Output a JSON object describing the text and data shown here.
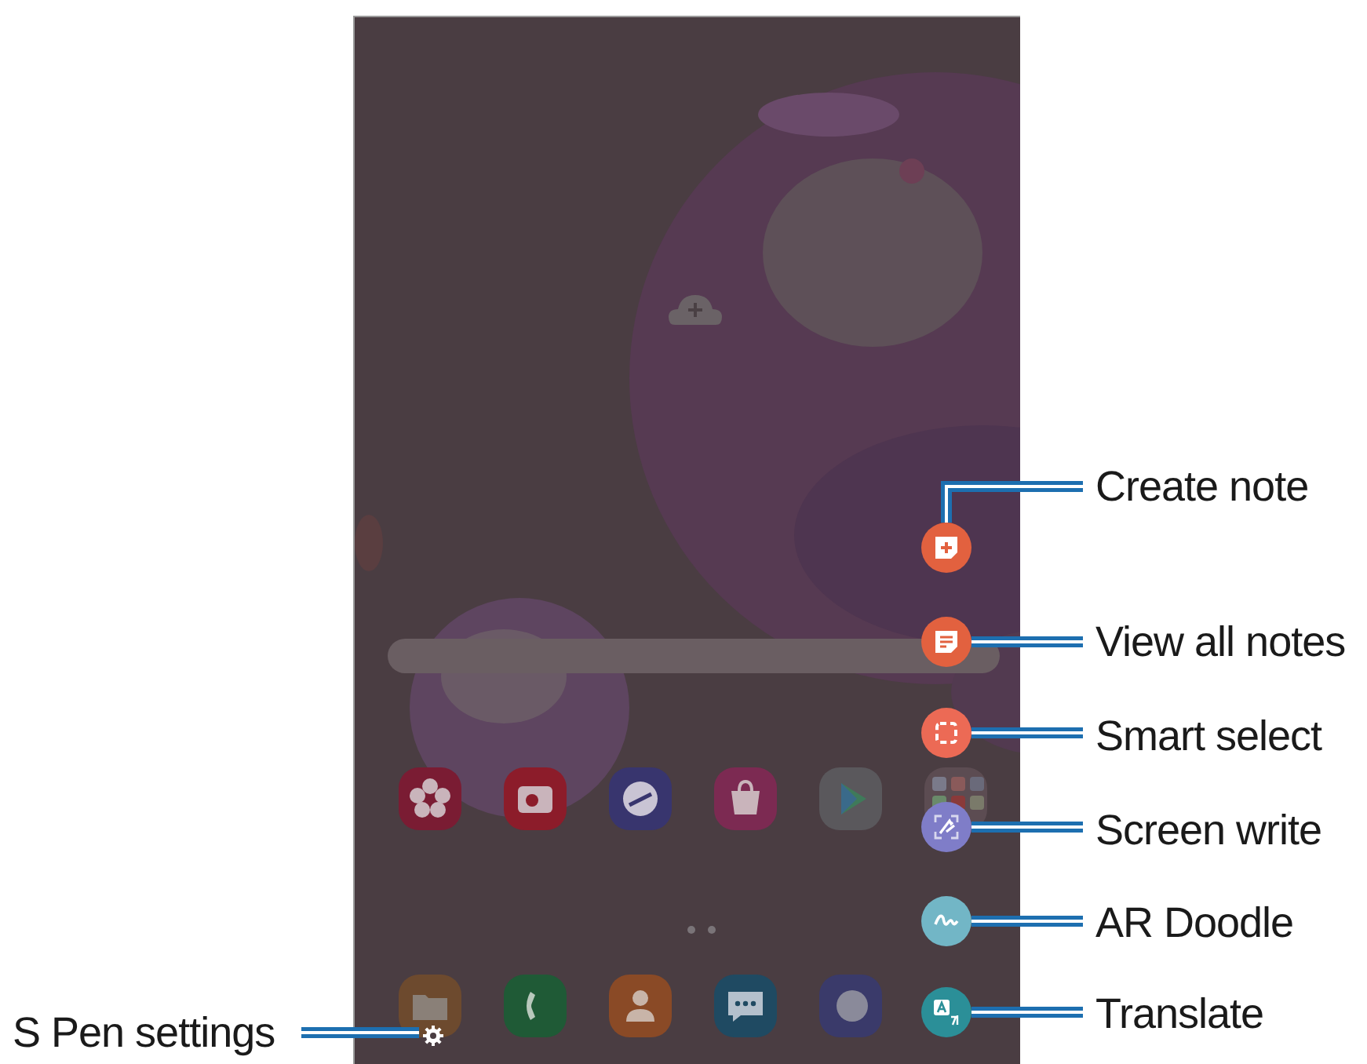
{
  "callouts": [
    {
      "label": "Create note",
      "kind": "create-note",
      "color": "#e2613f"
    },
    {
      "label": "View all notes",
      "kind": "view-notes",
      "color": "#e2613f"
    },
    {
      "label": "Smart select",
      "kind": "smart-select",
      "color": "#ec6a55"
    },
    {
      "label": "Screen write",
      "kind": "screen-write",
      "color": "#7f7dc8"
    },
    {
      "label": "AR Doodle",
      "kind": "ar-doodle",
      "color": "#72b6c6"
    },
    {
      "label": "Translate",
      "kind": "translate",
      "color": "#2b8f98"
    }
  ],
  "settings_callout": {
    "label": "S Pen settings"
  }
}
